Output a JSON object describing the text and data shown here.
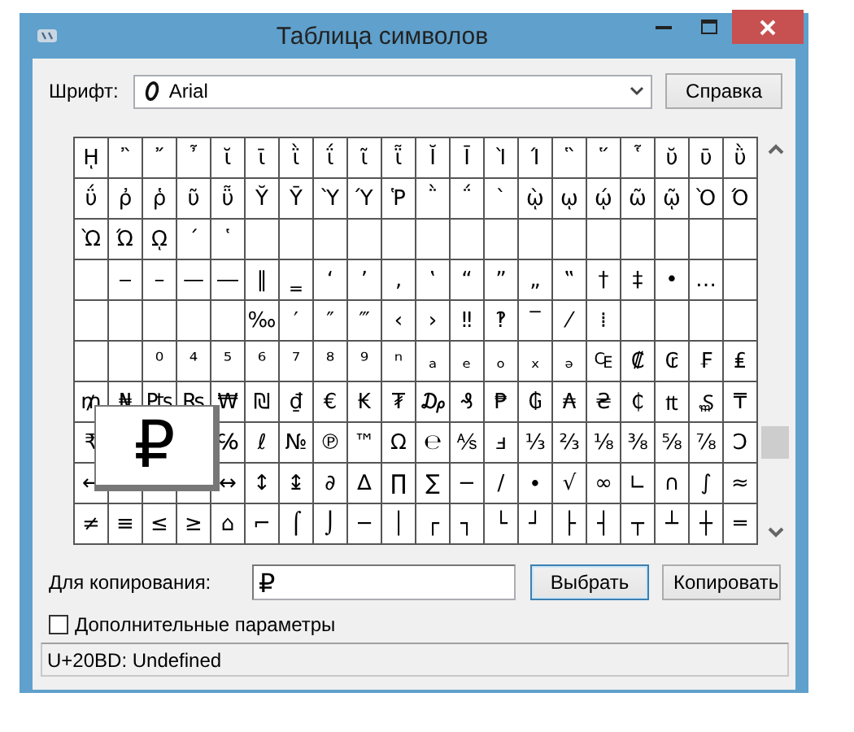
{
  "window": {
    "title": "Таблица символов"
  },
  "font": {
    "label": "Шрифт:",
    "value": "Arial"
  },
  "help_button": "Справка",
  "grid": {
    "rows": [
      [
        "ῌ",
        "῍",
        "῎",
        "῏",
        "ῐ",
        "ῑ",
        "ῒ",
        "ΐ",
        "ῖ",
        "ῗ",
        "Ῐ",
        "Ῑ",
        "Ὶ",
        "Ί",
        "῝",
        "῞",
        "῟",
        "ῠ",
        "ῡ",
        "ῢ"
      ],
      [
        "ΰ",
        "ῤ",
        "ῥ",
        "ῦ",
        "ῧ",
        "Ῠ",
        "Ῡ",
        "Ὺ",
        "Ύ",
        "Ῥ",
        "῭",
        "΅",
        "`",
        "ῲ",
        "ῳ",
        "ῴ",
        "ῶ",
        "ῷ",
        "Ὸ",
        "Ό"
      ],
      [
        "Ὼ",
        "Ώ",
        "ῼ",
        "´",
        "῾",
        null,
        null,
        null,
        null,
        null,
        null,
        null,
        null,
        null,
        null,
        null,
        null,
        null,
        null,
        null
      ],
      [
        null,
        "‒",
        "–",
        "—",
        "―",
        "‖",
        "‗",
        "‘",
        "’",
        "‚",
        "‛",
        "“",
        "”",
        "„",
        "‟",
        "†",
        "‡",
        "•",
        "…",
        null
      ],
      [
        null,
        null,
        null,
        null,
        null,
        "‰",
        "′",
        "″",
        "‴",
        "‹",
        "›",
        "‼",
        "‽",
        "‾",
        "⁄",
        "⁞",
        null,
        null,
        null,
        null
      ],
      [
        null,
        null,
        "⁰",
        "⁴",
        "⁵",
        "⁶",
        "⁷",
        "⁸",
        "⁹",
        "ⁿ",
        "ₐ",
        "ₑ",
        "ₒ",
        "ₓ",
        "ₔ",
        "₠",
        "₡",
        "₢",
        "₣",
        "₤"
      ],
      [
        "₥",
        "₦",
        "₧",
        "₨",
        "₩",
        "₪",
        "₫",
        "€",
        "₭",
        "₮",
        "₯",
        "₰",
        "₱",
        "₲",
        "₳",
        "₴",
        "₵",
        "₶",
        "₷",
        "₸"
      ],
      [
        "₹",
        null,
        null,
        null,
        "℅",
        "ℓ",
        "№",
        "℗",
        "™",
        "Ω",
        "℮",
        "⅍",
        "ⅎ",
        "⅓",
        "⅔",
        "⅛",
        "⅜",
        "⅝",
        "⅞",
        "Ↄ"
      ],
      [
        "←",
        null,
        null,
        null,
        "↔",
        "↕",
        "↨",
        "∂",
        "∆",
        "∏",
        "∑",
        "−",
        "∕",
        "∙",
        "√",
        "∞",
        "∟",
        "∩",
        "∫",
        "≈"
      ],
      [
        "≠",
        "≡",
        "≤",
        "≥",
        "⌂",
        "⌐",
        "⌠",
        "⌡",
        "─",
        "│",
        "┌",
        "┐",
        "└",
        "┘",
        "├",
        "┤",
        "┬",
        "┴",
        "┼",
        "═"
      ]
    ]
  },
  "magnified": "₽",
  "copy": {
    "label": "Для копирования:",
    "value": "₽"
  },
  "buttons": [
    {
      "label": "Выбрать",
      "default": true
    },
    {
      "label": "Копировать",
      "default": false
    }
  ],
  "advanced": {
    "label": "Дополнительные параметры",
    "checked": false
  },
  "status_bar": "U+20BD: Undefined"
}
